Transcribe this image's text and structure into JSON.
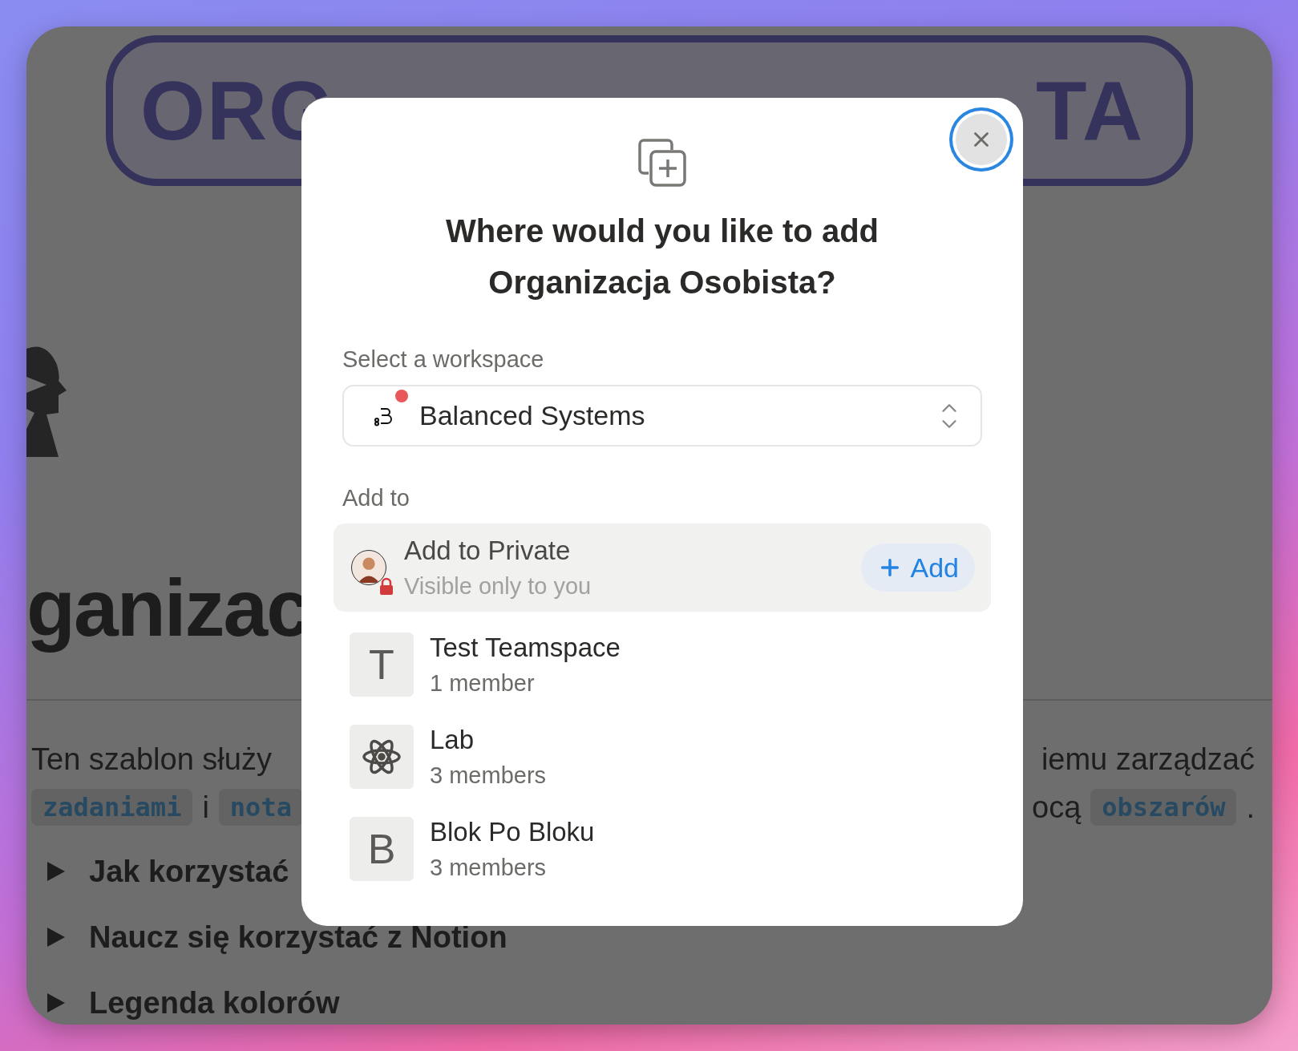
{
  "background_page": {
    "banner": [
      "ORG",
      "TA"
    ],
    "heading": "ganizac",
    "paragraph_lines": [
      {
        "left": [
          {
            "kind": "text",
            "text": "Ten szablon służy"
          }
        ],
        "right": [
          {
            "kind": "text",
            "text": "iemu zarządzać"
          }
        ]
      },
      {
        "left": [
          {
            "kind": "code",
            "text": "zadaniami"
          },
          {
            "kind": "text",
            "text": "i"
          },
          {
            "kind": "code",
            "text": "nota"
          }
        ],
        "right": [
          {
            "kind": "text",
            "text": "ocą"
          },
          {
            "kind": "code",
            "text": "obszarów"
          },
          {
            "kind": "text",
            "text": "."
          }
        ]
      }
    ],
    "toggles": [
      {
        "label": "Jak korzystać",
        "expanded": false
      },
      {
        "label": "Naucz się korzystać z Notion",
        "expanded": false
      },
      {
        "label": "Legenda kolorów",
        "expanded": false
      }
    ]
  },
  "dialog": {
    "title": "Where would you like to add Organizacja Osobista?",
    "close_focused": true,
    "workspace": {
      "label": "Select a workspace",
      "value": "Balanced Systems",
      "has_notification": true
    },
    "add_to": {
      "label": "Add to",
      "private": {
        "title": "Add to Private",
        "subtitle": "Visible only to you",
        "button": "Add",
        "highlighted": true
      },
      "teamspaces": [
        {
          "kind": "letter",
          "letter": "T",
          "name": "Test Teamspace",
          "members": "1 member"
        },
        {
          "kind": "atom",
          "name": "Lab",
          "members": "3 members"
        },
        {
          "kind": "letter",
          "letter": "B",
          "name": "Blok Po Bloku",
          "members": "3 members"
        }
      ]
    }
  }
}
